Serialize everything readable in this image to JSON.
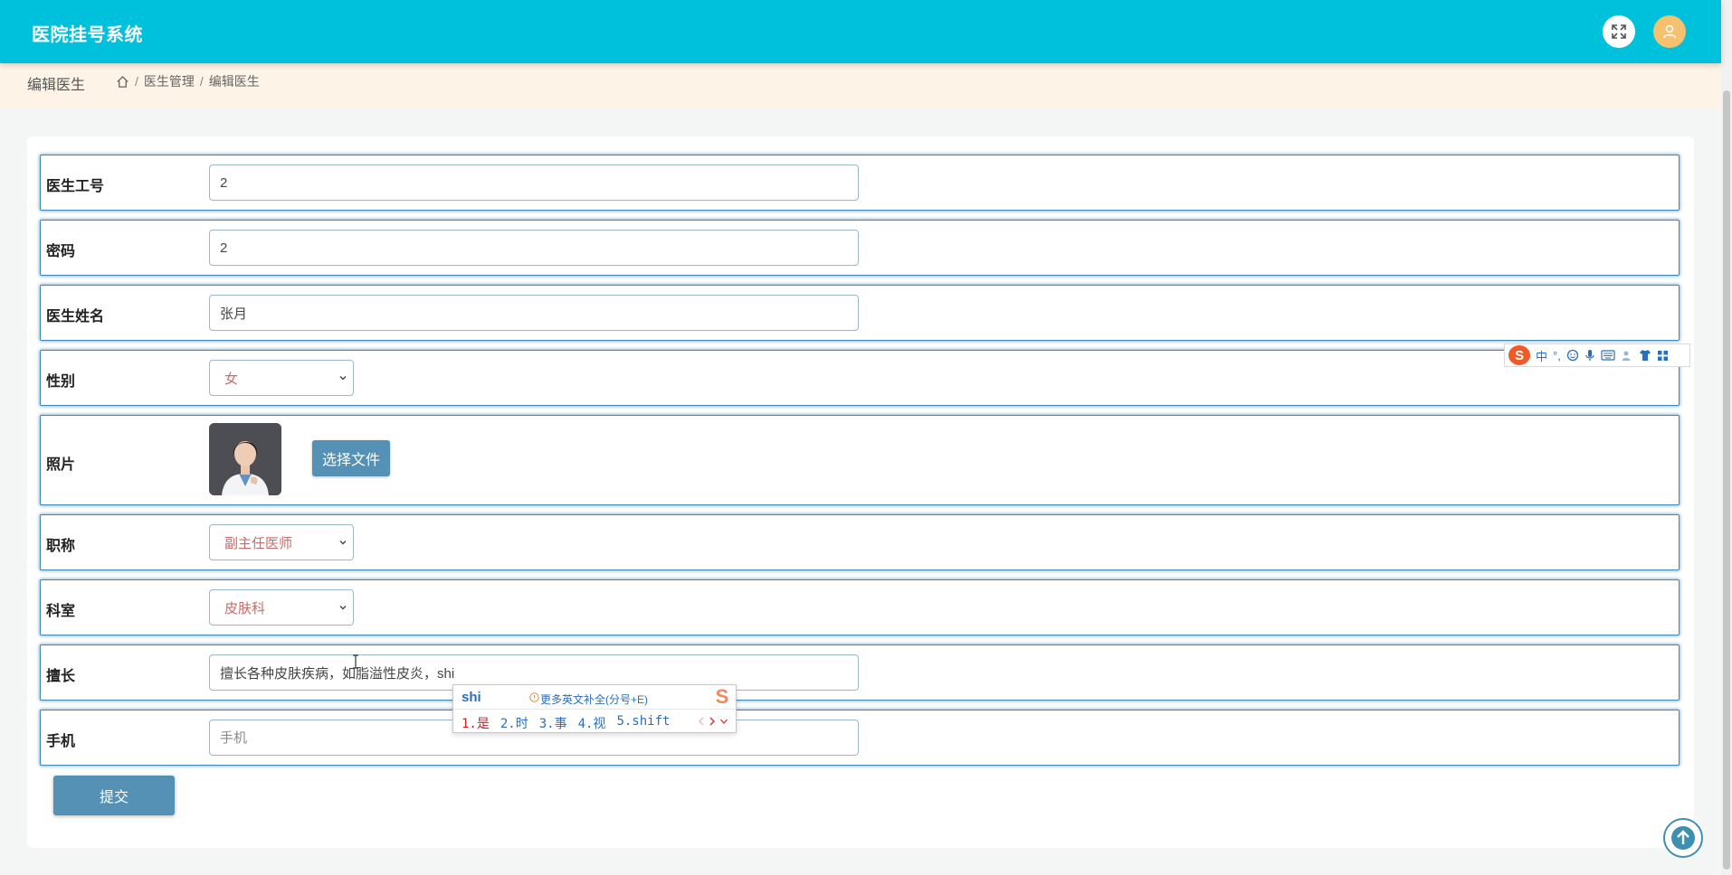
{
  "header": {
    "app_title": "医院挂号系统"
  },
  "breadcrumb": {
    "page_title": "编辑医生",
    "items": [
      "医生管理",
      "编辑医生"
    ],
    "separator": "/"
  },
  "form": {
    "fields": {
      "doctor_id": {
        "label": "医生工号",
        "value": "2"
      },
      "password": {
        "label": "密码",
        "value": "2"
      },
      "doctor_name": {
        "label": "医生姓名",
        "value": "张月"
      },
      "gender": {
        "label": "性别",
        "selected": "女"
      },
      "photo": {
        "label": "照片",
        "button": "选择文件"
      },
      "title": {
        "label": "职称",
        "selected": "副主任医师"
      },
      "department": {
        "label": "科室",
        "selected": "皮肤科"
      },
      "specialty": {
        "label": "擅长",
        "value": "擅长各种皮肤疾病，如脂溢性皮炎，shi"
      },
      "phone": {
        "label": "手机",
        "placeholder": "手机"
      }
    },
    "submit_label": "提交"
  },
  "ime": {
    "toolbar": {
      "logo": "S",
      "mode": "中",
      "punct": "°,"
    },
    "candidate": {
      "typed": "shi",
      "hint": "更多英文补全(分号+E)",
      "candidates": [
        "1.是",
        "2.时",
        "3.事",
        "4.视",
        "5.shift"
      ],
      "logo": "S"
    }
  },
  "colors": {
    "header_bg": "#00c1dc",
    "breadcrumb_bg": "#fdf3e6",
    "primary_button": "#5591b5",
    "row_border": "#3f87b6",
    "select_text": "#c56d6d"
  }
}
